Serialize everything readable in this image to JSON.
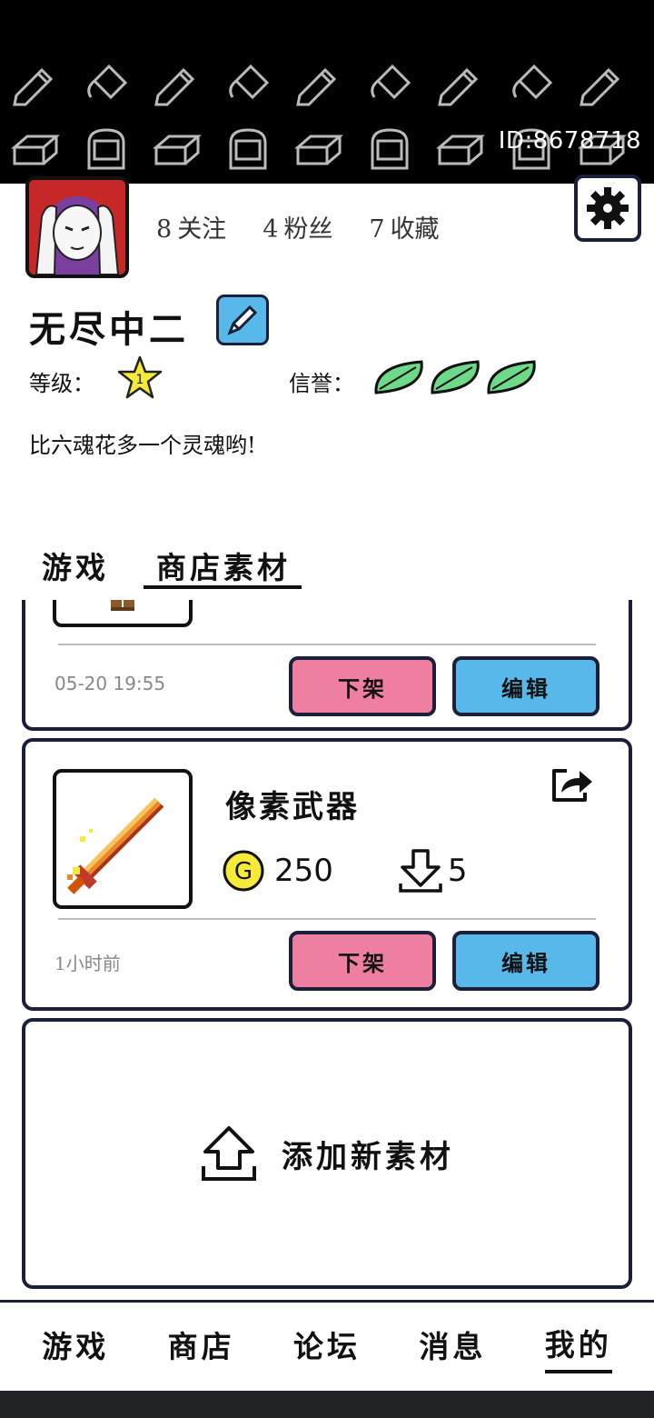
{
  "header": {
    "user_id": "ID:8678718"
  },
  "profile": {
    "following": {
      "count": "8",
      "label": "关注"
    },
    "followers": {
      "count": "4",
      "label": "粉丝"
    },
    "favorites": {
      "count": "7",
      "label": "收藏"
    },
    "username": "无尽中二",
    "level_label": "等级：",
    "level_value": "1",
    "reputation_label": "信誉：",
    "reputation_leaves": 3,
    "bio": "比六魂花多一个灵魂哟!"
  },
  "tabs": [
    {
      "label": "游戏",
      "active": false
    },
    {
      "label": "商店素材",
      "active": true
    }
  ],
  "items": [
    {
      "title": "",
      "time": "05-20 19:55",
      "unlist_label": "下架",
      "edit_label": "编辑"
    },
    {
      "title": "像素武器",
      "price": "250",
      "downloads": "5",
      "time": "1小时前",
      "unlist_label": "下架",
      "edit_label": "编辑"
    }
  ],
  "add_material": {
    "label": "添加新素材"
  },
  "bottom_nav": [
    {
      "label": "游戏",
      "active": false
    },
    {
      "label": "商店",
      "active": false
    },
    {
      "label": "论坛",
      "active": false
    },
    {
      "label": "消息",
      "active": false
    },
    {
      "label": "我的",
      "active": true
    }
  ],
  "colors": {
    "accent_blue": "#58b8ea",
    "accent_pink": "#ef7fa0",
    "leaf_green": "#6fd98a",
    "star_yellow": "#f5ea3a",
    "border_navy": "#1c1f3a"
  }
}
